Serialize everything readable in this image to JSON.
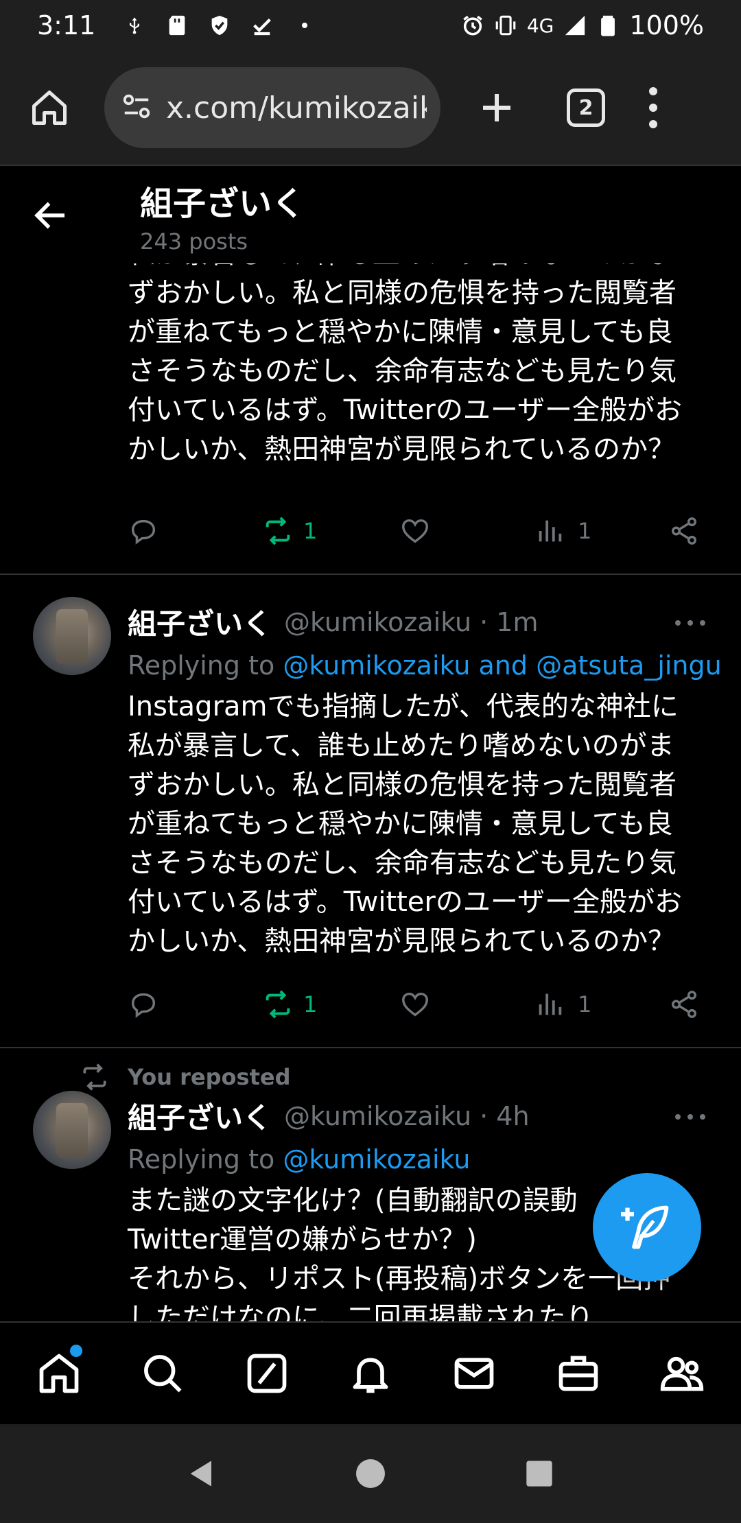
{
  "status_bar": {
    "time": "3:11",
    "network": "4G",
    "battery": "100%"
  },
  "browser": {
    "url": "x.com/kumikozaiku",
    "tab_count": "2"
  },
  "profile": {
    "name": "組子ざいく",
    "posts": "243 posts"
  },
  "partial_tweet": {
    "lines": [
      "私が暴言して、誰も止めたり嗜めないのがま",
      "ずおかしい。私と同様の危惧を持った閲覧者",
      "が重ねてもっと穏やかに陳情・意見しても良",
      "さそうなものだし、余命有志なども見たり気",
      "付いているはず。Twitterのユーザー全般がお",
      "かしいか、熱田神宮が見限られているのか？"
    ],
    "repost_count": "1",
    "view_count": "1"
  },
  "tweets": [
    {
      "name": "組子ざいく",
      "handle": "@kumikozaiku",
      "time": "· 1m",
      "replying_prefix": "Replying to ",
      "replying_to": "@kumikozaiku and @atsuta_jingu",
      "lines": [
        "Instagramでも指摘したが、代表的な神社に",
        "私が暴言して、誰も止めたり嗜めないのがま",
        "ずおかしい。私と同様の危惧を持った閲覧者",
        "が重ねてもっと穏やかに陳情・意見しても良",
        "さそうなものだし、余命有志なども見たり気",
        "付いているはず。Twitterのユーザー全般がお",
        "かしいか、熱田神宮が見限られているのか？"
      ],
      "repost_count": "1",
      "view_count": "1"
    },
    {
      "repost_label": "You reposted",
      "name": "組子ざいく",
      "handle": "@kumikozaiku",
      "time": "· 4h",
      "replying_prefix": "Replying to ",
      "replying_to": "@kumikozaiku",
      "lines": [
        "また謎の文字化け？(自動翻訳の誤動",
        "Twitter運営の嫌がらせか？)",
        "それから、リポスト(再投稿)ボタンを一回押",
        "しただけなのに、二回再掲載されたり"
      ]
    }
  ],
  "colors": {
    "accent": "#1d9bf0",
    "repost_green": "#00ba7c",
    "muted": "#71767b",
    "background": "#000000"
  }
}
